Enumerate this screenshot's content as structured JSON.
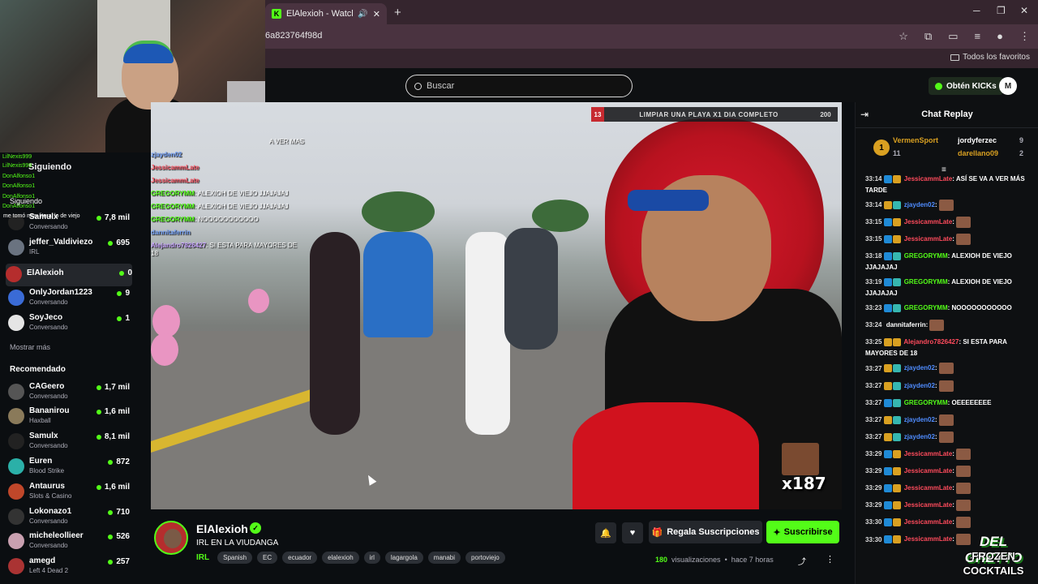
{
  "browser": {
    "tab_title": "ElAlexioh - Watch the VOD",
    "url": "6a823764f98d",
    "bookmarks_folder": "Todos los favoritos"
  },
  "kick": {
    "search_placeholder": "Buscar",
    "get_kicks": "Obtén KICKs",
    "user_initial": "M"
  },
  "sidebar": {
    "following_title": "Siguiendo",
    "mini_title": "Siguiendo",
    "overlay_names": [
      "LilNexis999",
      "LilNexis999",
      "DonAlfonso1",
      "DonAlfonso1",
      "DonAlfonso1",
      "DonAlfonso1"
    ],
    "overlay_msg": "me tomó muy literal lo de viejo",
    "following": [
      {
        "name": "Samulx",
        "sub": "Conversando",
        "viewers": "7,8 mil",
        "color": "#222"
      },
      {
        "name": "jeffer_Valdiviezo",
        "sub": "IRL",
        "viewers": "695",
        "color": "#6a7380"
      },
      {
        "name": "ElAlexioh",
        "sub": "",
        "viewers": "0",
        "color": "#b52d2d"
      },
      {
        "name": "OnlyJordan1223",
        "sub": "Conversando",
        "viewers": "9",
        "color": "#3a6bd6"
      },
      {
        "name": "SoyJeco",
        "sub": "Conversando",
        "viewers": "1",
        "color": "#e5e5e5"
      }
    ],
    "show_more": "Mostrar más",
    "recommended_title": "Recomendado",
    "recommended": [
      {
        "name": "CAGeero",
        "sub": "Conversando",
        "viewers": "1,7 mil",
        "color": "#555"
      },
      {
        "name": "Bananirou",
        "sub": "Haxball",
        "viewers": "1,6 mil",
        "color": "#8a7a5a"
      },
      {
        "name": "Samulx",
        "sub": "Conversando",
        "viewers": "8,1 mil",
        "color": "#222"
      },
      {
        "name": "Euren",
        "sub": "Blood Strike",
        "viewers": "872",
        "color": "#2bb0a8"
      },
      {
        "name": "Antaurus",
        "sub": "Slots & Casino",
        "viewers": "1,6 mil",
        "color": "#c0472a"
      },
      {
        "name": "Lokonazo1",
        "sub": "Conversando",
        "viewers": "710",
        "color": "#333"
      },
      {
        "name": "micheleollieer",
        "sub": "Conversando",
        "viewers": "526",
        "color": "#c9a0b0"
      },
      {
        "name": "amegd",
        "sub": "Left 4 Dead 2",
        "viewers": "257",
        "color": "#a33"
      }
    ]
  },
  "video": {
    "goal_number": "13",
    "goal_text": "LIMPIAR UNA PLAYA X1 DIA COMPLETO",
    "goal_count": "200",
    "edge_text": "A VER MAS",
    "overlay_chat": [
      {
        "user": "zjayden02",
        "text": "",
        "cls": "u1"
      },
      {
        "user": "JessicammLate",
        "text": "",
        "cls": "u2"
      },
      {
        "user": "JessicammLate",
        "text": "",
        "cls": "u2"
      },
      {
        "user": "GREGORYMM",
        "text": "ALEXIOH DE VIEJO JJAJAJAJ",
        "cls": "u3"
      },
      {
        "user": "GREGORYMM",
        "text": "ALEXIOH DE VIEJO JJAJAJAJ",
        "cls": "u3"
      },
      {
        "user": "GREGORYMM",
        "text": "NOOOOOOOOOOO",
        "cls": "u3"
      },
      {
        "user": "dannitaferrin",
        "text": "",
        "cls": "u1"
      },
      {
        "user": "Alejandro7826427",
        "text": "SI ESTA PARA MAYORES DE 18",
        "cls": "u4"
      }
    ],
    "multiplier": "x187"
  },
  "stream": {
    "name": "ElAlexioh",
    "title": "IRL EN LA VIUDANGA",
    "category": "IRL",
    "tags": [
      "Spanish",
      "EC",
      "ecuador",
      "elalexioh",
      "irl",
      "lagargola",
      "manabi",
      "portoviejo"
    ],
    "gift_label": "Regala Suscripciones",
    "subscribe_label": "Suscribirse",
    "views": "180",
    "views_label": "visualizaciones",
    "age": "hace 7 horas"
  },
  "chat": {
    "title": "Chat Replay",
    "leaderboard": {
      "first": {
        "rank": "1",
        "name": "VermenSport",
        "count": "11"
      },
      "second": {
        "name": "jordyferzec",
        "count": "9"
      },
      "third": {
        "name": "darellano09",
        "count": "2"
      }
    },
    "messages": [
      {
        "time": "33:14",
        "badges": [
          "b-blue",
          "b-gold"
        ],
        "user": "JessicammLate",
        "ucls": "u-red",
        "text": "ASÍ SE VA A VER MÁS TARDE",
        "emote": false
      },
      {
        "time": "33:14",
        "badges": [
          "b-gold",
          "b-teal"
        ],
        "user": "zjayden02",
        "ucls": "u-blue",
        "text": "",
        "emote": true
      },
      {
        "time": "33:15",
        "badges": [
          "b-blue",
          "b-gold"
        ],
        "user": "JessicammLate",
        "ucls": "u-red",
        "text": "",
        "emote": true
      },
      {
        "time": "33:15",
        "badges": [
          "b-blue",
          "b-gold"
        ],
        "user": "JessicammLate",
        "ucls": "u-red",
        "text": "",
        "emote": true
      },
      {
        "time": "33:18",
        "badges": [
          "b-blue",
          "b-teal"
        ],
        "user": "GREGORYMM",
        "ucls": "u-green",
        "text": "ALEXIOH DE VIEJO JJAJAJAJ",
        "emote": false
      },
      {
        "time": "33:19",
        "badges": [
          "b-blue",
          "b-teal"
        ],
        "user": "GREGORYMM",
        "ucls": "u-green",
        "text": "ALEXIOH DE VIEJO JJAJAJAJ",
        "emote": false
      },
      {
        "time": "33:23",
        "badges": [
          "b-blue",
          "b-teal"
        ],
        "user": "GREGORYMM",
        "ucls": "u-green",
        "text": "NOOOOOOOOOOO",
        "emote": false
      },
      {
        "time": "33:24",
        "badges": [],
        "user": "dannitaferrin",
        "ucls": "u-white",
        "text": "",
        "emote": true
      },
      {
        "time": "33:25",
        "badges": [
          "b-gold",
          "b-gold"
        ],
        "user": "Alejandro7826427",
        "ucls": "u-red",
        "text": "SI ESTA PARA MAYORES DE 18",
        "emote": false
      },
      {
        "time": "33:27",
        "badges": [
          "b-gold",
          "b-teal"
        ],
        "user": "zjayden02",
        "ucls": "u-blue",
        "text": "",
        "emote": true
      },
      {
        "time": "33:27",
        "badges": [
          "b-gold",
          "b-teal"
        ],
        "user": "zjayden02",
        "ucls": "u-blue",
        "text": "",
        "emote": true
      },
      {
        "time": "33:27",
        "badges": [
          "b-blue",
          "b-teal"
        ],
        "user": "GREGORYMM",
        "ucls": "u-green",
        "text": "OEEEEEEEE",
        "emote": false
      },
      {
        "time": "33:27",
        "badges": [
          "b-gold",
          "b-teal"
        ],
        "user": "zjayden02",
        "ucls": "u-blue",
        "text": "",
        "emote": true
      },
      {
        "time": "33:27",
        "badges": [
          "b-gold",
          "b-teal"
        ],
        "user": "zjayden02",
        "ucls": "u-blue",
        "text": "",
        "emote": true
      },
      {
        "time": "33:29",
        "badges": [
          "b-blue",
          "b-gold"
        ],
        "user": "JessicammLate",
        "ucls": "u-red",
        "text": "",
        "emote": true
      },
      {
        "time": "33:29",
        "badges": [
          "b-blue",
          "b-gold"
        ],
        "user": "JessicammLate",
        "ucls": "u-red",
        "text": "",
        "emote": true
      },
      {
        "time": "33:29",
        "badges": [
          "b-blue",
          "b-gold"
        ],
        "user": "JessicammLate",
        "ucls": "u-red",
        "text": "",
        "emote": true
      },
      {
        "time": "33:29",
        "badges": [
          "b-blue",
          "b-gold"
        ],
        "user": "JessicammLate",
        "ucls": "u-red",
        "text": "",
        "emote": true
      },
      {
        "time": "33:30",
        "badges": [
          "b-blue",
          "b-gold"
        ],
        "user": "JessicammLate",
        "ucls": "u-red",
        "text": "",
        "emote": true
      },
      {
        "time": "33:30",
        "badges": [
          "b-blue",
          "b-gold"
        ],
        "user": "JessicammLate",
        "ucls": "u-red",
        "text": "",
        "emote": true
      }
    ]
  },
  "watermark": {
    "line1": "DEL GHETTO",
    "line2": "FROZEN",
    "line3": "COCKTAILS"
  }
}
